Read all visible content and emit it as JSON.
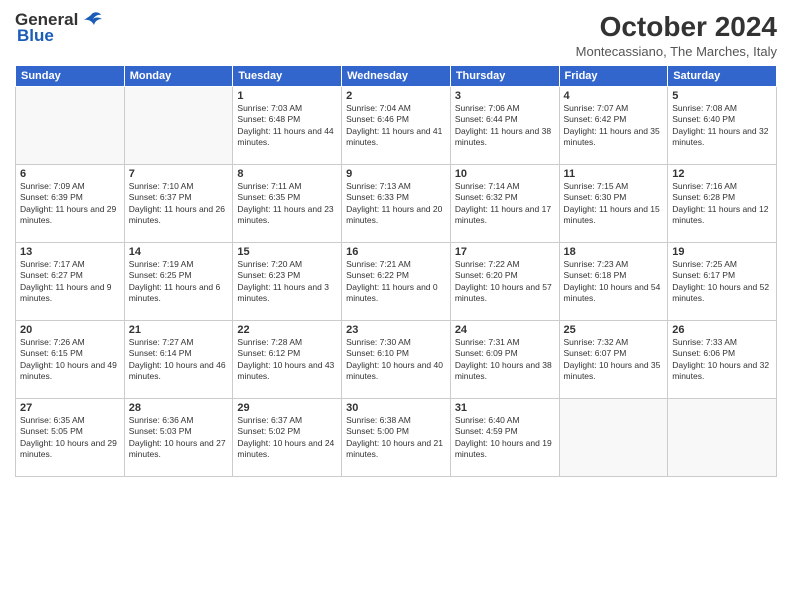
{
  "header": {
    "logo_general": "General",
    "logo_blue": "Blue",
    "month_title": "October 2024",
    "subtitle": "Montecassiano, The Marches, Italy"
  },
  "weekdays": [
    "Sunday",
    "Monday",
    "Tuesday",
    "Wednesday",
    "Thursday",
    "Friday",
    "Saturday"
  ],
  "weeks": [
    [
      {
        "day": "",
        "sunrise": "",
        "sunset": "",
        "daylight": ""
      },
      {
        "day": "",
        "sunrise": "",
        "sunset": "",
        "daylight": ""
      },
      {
        "day": "1",
        "sunrise": "Sunrise: 7:03 AM",
        "sunset": "Sunset: 6:48 PM",
        "daylight": "Daylight: 11 hours and 44 minutes."
      },
      {
        "day": "2",
        "sunrise": "Sunrise: 7:04 AM",
        "sunset": "Sunset: 6:46 PM",
        "daylight": "Daylight: 11 hours and 41 minutes."
      },
      {
        "day": "3",
        "sunrise": "Sunrise: 7:06 AM",
        "sunset": "Sunset: 6:44 PM",
        "daylight": "Daylight: 11 hours and 38 minutes."
      },
      {
        "day": "4",
        "sunrise": "Sunrise: 7:07 AM",
        "sunset": "Sunset: 6:42 PM",
        "daylight": "Daylight: 11 hours and 35 minutes."
      },
      {
        "day": "5",
        "sunrise": "Sunrise: 7:08 AM",
        "sunset": "Sunset: 6:40 PM",
        "daylight": "Daylight: 11 hours and 32 minutes."
      }
    ],
    [
      {
        "day": "6",
        "sunrise": "Sunrise: 7:09 AM",
        "sunset": "Sunset: 6:39 PM",
        "daylight": "Daylight: 11 hours and 29 minutes."
      },
      {
        "day": "7",
        "sunrise": "Sunrise: 7:10 AM",
        "sunset": "Sunset: 6:37 PM",
        "daylight": "Daylight: 11 hours and 26 minutes."
      },
      {
        "day": "8",
        "sunrise": "Sunrise: 7:11 AM",
        "sunset": "Sunset: 6:35 PM",
        "daylight": "Daylight: 11 hours and 23 minutes."
      },
      {
        "day": "9",
        "sunrise": "Sunrise: 7:13 AM",
        "sunset": "Sunset: 6:33 PM",
        "daylight": "Daylight: 11 hours and 20 minutes."
      },
      {
        "day": "10",
        "sunrise": "Sunrise: 7:14 AM",
        "sunset": "Sunset: 6:32 PM",
        "daylight": "Daylight: 11 hours and 17 minutes."
      },
      {
        "day": "11",
        "sunrise": "Sunrise: 7:15 AM",
        "sunset": "Sunset: 6:30 PM",
        "daylight": "Daylight: 11 hours and 15 minutes."
      },
      {
        "day": "12",
        "sunrise": "Sunrise: 7:16 AM",
        "sunset": "Sunset: 6:28 PM",
        "daylight": "Daylight: 11 hours and 12 minutes."
      }
    ],
    [
      {
        "day": "13",
        "sunrise": "Sunrise: 7:17 AM",
        "sunset": "Sunset: 6:27 PM",
        "daylight": "Daylight: 11 hours and 9 minutes."
      },
      {
        "day": "14",
        "sunrise": "Sunrise: 7:19 AM",
        "sunset": "Sunset: 6:25 PM",
        "daylight": "Daylight: 11 hours and 6 minutes."
      },
      {
        "day": "15",
        "sunrise": "Sunrise: 7:20 AM",
        "sunset": "Sunset: 6:23 PM",
        "daylight": "Daylight: 11 hours and 3 minutes."
      },
      {
        "day": "16",
        "sunrise": "Sunrise: 7:21 AM",
        "sunset": "Sunset: 6:22 PM",
        "daylight": "Daylight: 11 hours and 0 minutes."
      },
      {
        "day": "17",
        "sunrise": "Sunrise: 7:22 AM",
        "sunset": "Sunset: 6:20 PM",
        "daylight": "Daylight: 10 hours and 57 minutes."
      },
      {
        "day": "18",
        "sunrise": "Sunrise: 7:23 AM",
        "sunset": "Sunset: 6:18 PM",
        "daylight": "Daylight: 10 hours and 54 minutes."
      },
      {
        "day": "19",
        "sunrise": "Sunrise: 7:25 AM",
        "sunset": "Sunset: 6:17 PM",
        "daylight": "Daylight: 10 hours and 52 minutes."
      }
    ],
    [
      {
        "day": "20",
        "sunrise": "Sunrise: 7:26 AM",
        "sunset": "Sunset: 6:15 PM",
        "daylight": "Daylight: 10 hours and 49 minutes."
      },
      {
        "day": "21",
        "sunrise": "Sunrise: 7:27 AM",
        "sunset": "Sunset: 6:14 PM",
        "daylight": "Daylight: 10 hours and 46 minutes."
      },
      {
        "day": "22",
        "sunrise": "Sunrise: 7:28 AM",
        "sunset": "Sunset: 6:12 PM",
        "daylight": "Daylight: 10 hours and 43 minutes."
      },
      {
        "day": "23",
        "sunrise": "Sunrise: 7:30 AM",
        "sunset": "Sunset: 6:10 PM",
        "daylight": "Daylight: 10 hours and 40 minutes."
      },
      {
        "day": "24",
        "sunrise": "Sunrise: 7:31 AM",
        "sunset": "Sunset: 6:09 PM",
        "daylight": "Daylight: 10 hours and 38 minutes."
      },
      {
        "day": "25",
        "sunrise": "Sunrise: 7:32 AM",
        "sunset": "Sunset: 6:07 PM",
        "daylight": "Daylight: 10 hours and 35 minutes."
      },
      {
        "day": "26",
        "sunrise": "Sunrise: 7:33 AM",
        "sunset": "Sunset: 6:06 PM",
        "daylight": "Daylight: 10 hours and 32 minutes."
      }
    ],
    [
      {
        "day": "27",
        "sunrise": "Sunrise: 6:35 AM",
        "sunset": "Sunset: 5:05 PM",
        "daylight": "Daylight: 10 hours and 29 minutes."
      },
      {
        "day": "28",
        "sunrise": "Sunrise: 6:36 AM",
        "sunset": "Sunset: 5:03 PM",
        "daylight": "Daylight: 10 hours and 27 minutes."
      },
      {
        "day": "29",
        "sunrise": "Sunrise: 6:37 AM",
        "sunset": "Sunset: 5:02 PM",
        "daylight": "Daylight: 10 hours and 24 minutes."
      },
      {
        "day": "30",
        "sunrise": "Sunrise: 6:38 AM",
        "sunset": "Sunset: 5:00 PM",
        "daylight": "Daylight: 10 hours and 21 minutes."
      },
      {
        "day": "31",
        "sunrise": "Sunrise: 6:40 AM",
        "sunset": "Sunset: 4:59 PM",
        "daylight": "Daylight: 10 hours and 19 minutes."
      },
      {
        "day": "",
        "sunrise": "",
        "sunset": "",
        "daylight": ""
      },
      {
        "day": "",
        "sunrise": "",
        "sunset": "",
        "daylight": ""
      }
    ]
  ]
}
